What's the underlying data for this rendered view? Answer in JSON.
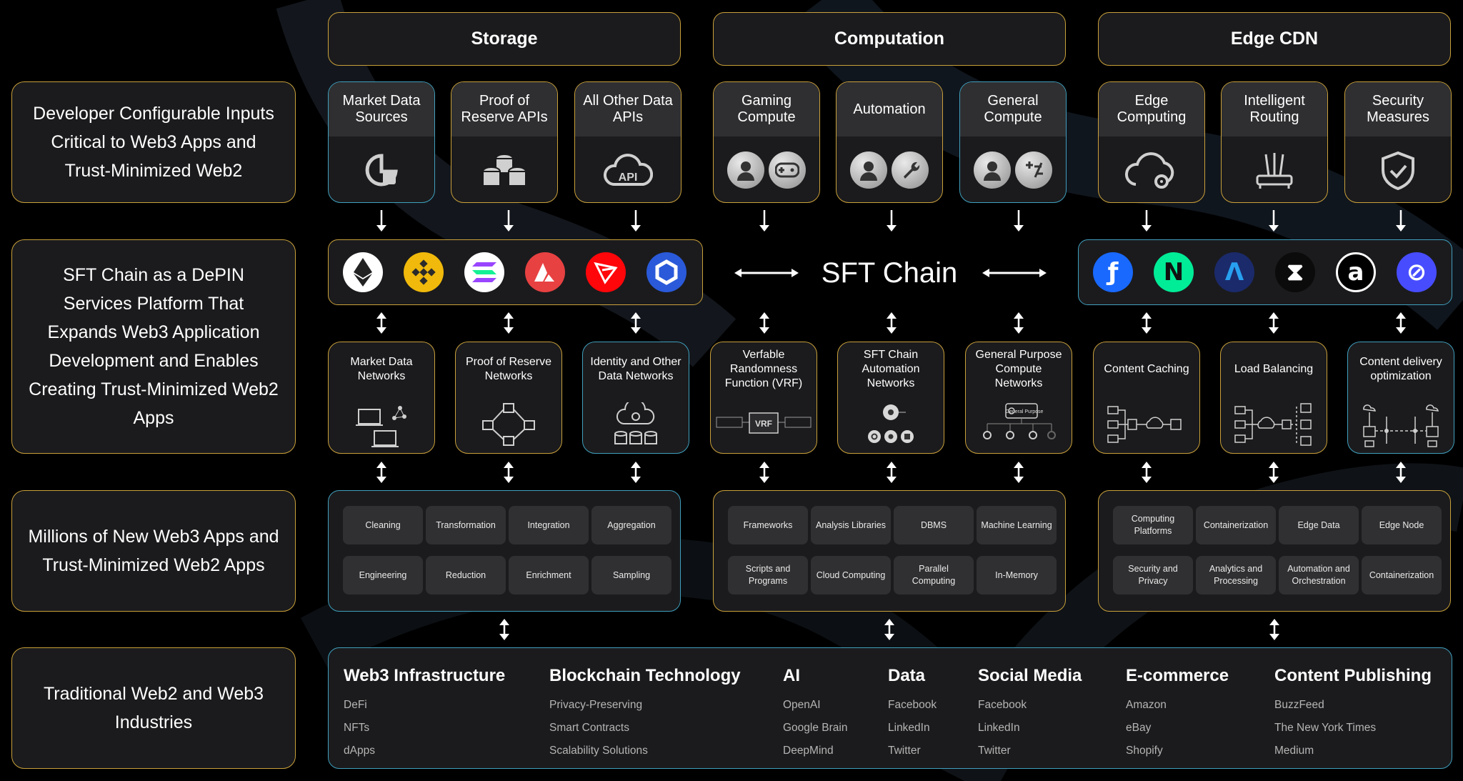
{
  "row_labels": [
    "Developer Configurable Inputs Critical to Web3 Apps and Trust-Minimized Web2",
    "SFT Chain as a DePIN Services Platform That Expands Web3 Application Development and Enables Creating Trust-Minimized Web2 Apps",
    "Millions of New Web3 Apps and Trust-Minimized Web2 Apps",
    "Traditional Web2 and Web3 Industries"
  ],
  "columns": [
    "Storage",
    "Computation",
    "Edge CDN"
  ],
  "inputs": [
    {
      "label": "Market Data Sources",
      "icon": "chart-data-icon"
    },
    {
      "label": "Proof of Reserve APIs",
      "icon": "coin-stack-icon"
    },
    {
      "label": "All Other Data APIs",
      "icon": "api-cloud-icon"
    },
    {
      "label": "Gaming Compute",
      "icon": "user-gamepad-icon"
    },
    {
      "label": "Automation",
      "icon": "user-wrench-icon"
    },
    {
      "label": "General Compute",
      "icon": "user-calculator-icon"
    },
    {
      "label": "Edge Computing",
      "icon": "cloud-gear-icon"
    },
    {
      "label": "Intelligent Routing",
      "icon": "router-icon"
    },
    {
      "label": "Security Measures",
      "icon": "shield-check-icon"
    }
  ],
  "center_label": "SFT Chain",
  "chain_logos_left": [
    {
      "name": "ethereum-logo",
      "bg": "#ffffff",
      "fg": "#222222"
    },
    {
      "name": "bnb-logo",
      "bg": "#f0b90b",
      "fg": "#2b2b2b"
    },
    {
      "name": "solana-logo",
      "bg": "#ffffff",
      "fg": "#9945ff"
    },
    {
      "name": "avalanche-logo",
      "bg": "#e84142",
      "fg": "#ffffff"
    },
    {
      "name": "tron-logo",
      "bg": "#ff060a",
      "fg": "#ffffff"
    },
    {
      "name": "chainlink-logo",
      "bg": "#2a5ada",
      "fg": "#ffffff"
    }
  ],
  "chain_logos_right": [
    {
      "name": "fantom-logo",
      "bg": "#1969ff",
      "fg": "#ffffff",
      "glyph": "ƒ"
    },
    {
      "name": "near-logo",
      "bg": "#00ec97",
      "fg": "#111111",
      "glyph": "N"
    },
    {
      "name": "arbitrum-logo",
      "bg": "#1b2a6b",
      "fg": "#28a0f0",
      "glyph": "Λ"
    },
    {
      "name": "hourglass-logo",
      "bg": "#0b0b0b",
      "fg": "#ffffff",
      "glyph": "⧗"
    },
    {
      "name": "arweave-logo",
      "bg": "#000000",
      "fg": "#ffffff",
      "glyph": "a"
    },
    {
      "name": "helium-logo",
      "bg": "#474dff",
      "fg": "#ffffff",
      "glyph": "⊘"
    }
  ],
  "networks": [
    "Market Data Networks",
    "Proof of Reserve Networks",
    "Identity and Other Data Networks",
    "Verfable Randomness Function (VRF)",
    "SFT Chain Automation Networks",
    "General Purpose Compute Networks",
    "Content Caching",
    "Load Balancing",
    "Content delivery optimization"
  ],
  "network_mini_text": {
    "vrf": "VRF",
    "general_purpose": "General Purpose"
  },
  "storage_chips": [
    "Cleaning",
    "Transformation",
    "Integration",
    "Aggregation",
    "Engineering",
    "Reduction",
    "Enrichment",
    "Sampling"
  ],
  "computation_chips": [
    "Frameworks",
    "Analysis Libraries",
    "DBMS",
    "Machine Learning",
    "Scripts and Programs",
    "Cloud Computing",
    "Parallel Computing",
    "In-Memory"
  ],
  "edge_chips": [
    "Computing Platforms",
    "Containerization",
    "Edge Data",
    "Edge Node",
    "Security and Privacy",
    "Analytics and Processing",
    "Automation and Orchestration",
    "Containerization"
  ],
  "industries": [
    {
      "title": "Web3 Infrastructure",
      "items": [
        "DeFi",
        "NFTs",
        "dApps"
      ]
    },
    {
      "title": "Blockchain Technology",
      "items": [
        "Privacy-Preserving",
        "Smart Contracts",
        "Scalability Solutions"
      ]
    },
    {
      "title": "AI",
      "items": [
        "OpenAI",
        "Google Brain",
        "DeepMind"
      ]
    },
    {
      "title": "Data",
      "items": [
        "Facebook",
        "LinkedIn",
        "Twitter"
      ]
    },
    {
      "title": "Social Media",
      "items": [
        "Facebook",
        "LinkedIn",
        "Twitter"
      ]
    },
    {
      "title": "E-commerce",
      "items": [
        "Amazon",
        "eBay",
        "Shopify"
      ]
    },
    {
      "title": "Content Publishing",
      "items": [
        "BuzzFeed",
        "The New York Times",
        "Medium"
      ]
    }
  ],
  "colors": {
    "gold_border": "#c9a03a",
    "blue_border": "#3f9fbd",
    "panel": "#1b1b1d",
    "chip": "#303032"
  }
}
